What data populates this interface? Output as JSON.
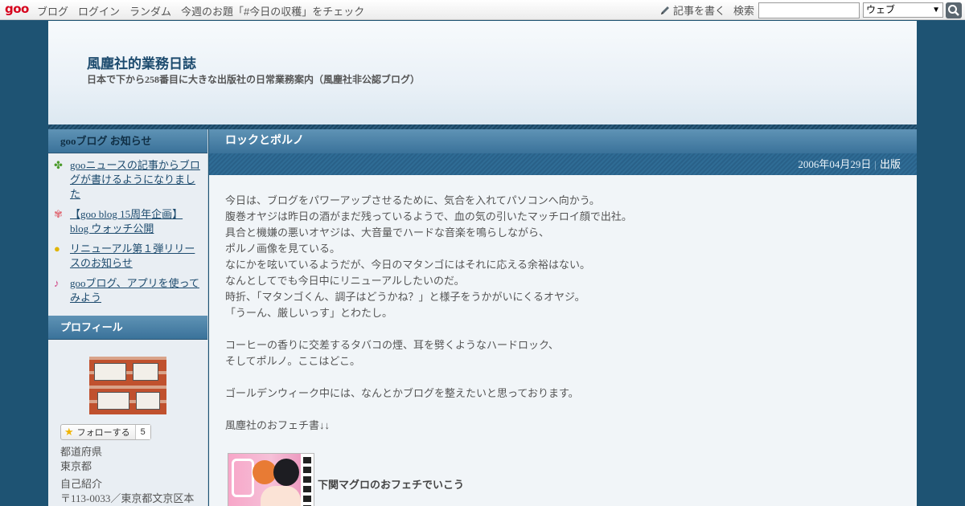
{
  "topbar": {
    "logo": "goo",
    "nav": [
      "ブログ",
      "ログイン",
      "ランダム",
      "今週のお題「#今日の収穫」をチェック"
    ],
    "write_label": "記事を書く",
    "search_label": "検索",
    "search_value": "",
    "search_scope": "ウェブ"
  },
  "header": {
    "title": "風塵社的業務日誌",
    "subtitle": "日本で下から258番目に大きな出版社の日常業務案内（風塵社非公認ブログ）"
  },
  "sidebar": {
    "notice_heading": "gooブログ お知らせ",
    "notices": [
      {
        "icon": "clover-icon",
        "label": "gooニュースの記事からブログが書けるようになりました"
      },
      {
        "icon": "flower-icon",
        "label": "【goo blog 15周年企画】blog ウォッチ公開"
      },
      {
        "icon": "lightbulb-icon",
        "label": "リニューアル第１弾リリースのお知らせ"
      },
      {
        "icon": "music-note-icon",
        "label": "gooブログ、アプリを使ってみよう"
      }
    ],
    "profile_heading": "プロフィール",
    "follow_label": "フォローする",
    "follow_count": "5",
    "prefecture_label": "都道府県",
    "prefecture_value": "東京都",
    "intro_label": "自己紹介",
    "intro_value": "〒113-0033／東京都文京区本"
  },
  "post": {
    "title": "ロックとポルノ",
    "date": "2006年04月29日",
    "category": "出版",
    "lines": [
      "今日は、ブログをパワーアップさせるために、気合を入れてパソコンへ向かう。",
      "腹巻オヤジは昨日の酒がまだ残っているようで、血の気の引いたマッチロイ顔で出社。",
      "具合と機嫌の悪いオヤジは、大音量でハードな音楽を鳴らしながら、",
      "ポルノ画像を見ている。",
      "なにかを呟いているようだが、今日のマタンゴにはそれに応える余裕はない。",
      "なんとしてでも今日中にリニューアルしたいのだ。",
      "時折、「マタンゴくん、調子はどうかね？」と様子をうかがいにくるオヤジ。",
      "「うーん、厳しいっす」とわたし。",
      "",
      "コーヒーの香りに交差するタバコの煙、耳を劈くようなハードロック、",
      "そしてポルノ。ここはどこ。",
      "",
      "ゴールデンウィーク中には、なんとかブログを整えたいと思っております。",
      "",
      "風塵社のおフェチ書↓↓"
    ],
    "book_title": "下関マグロのおフェチでいこう"
  }
}
